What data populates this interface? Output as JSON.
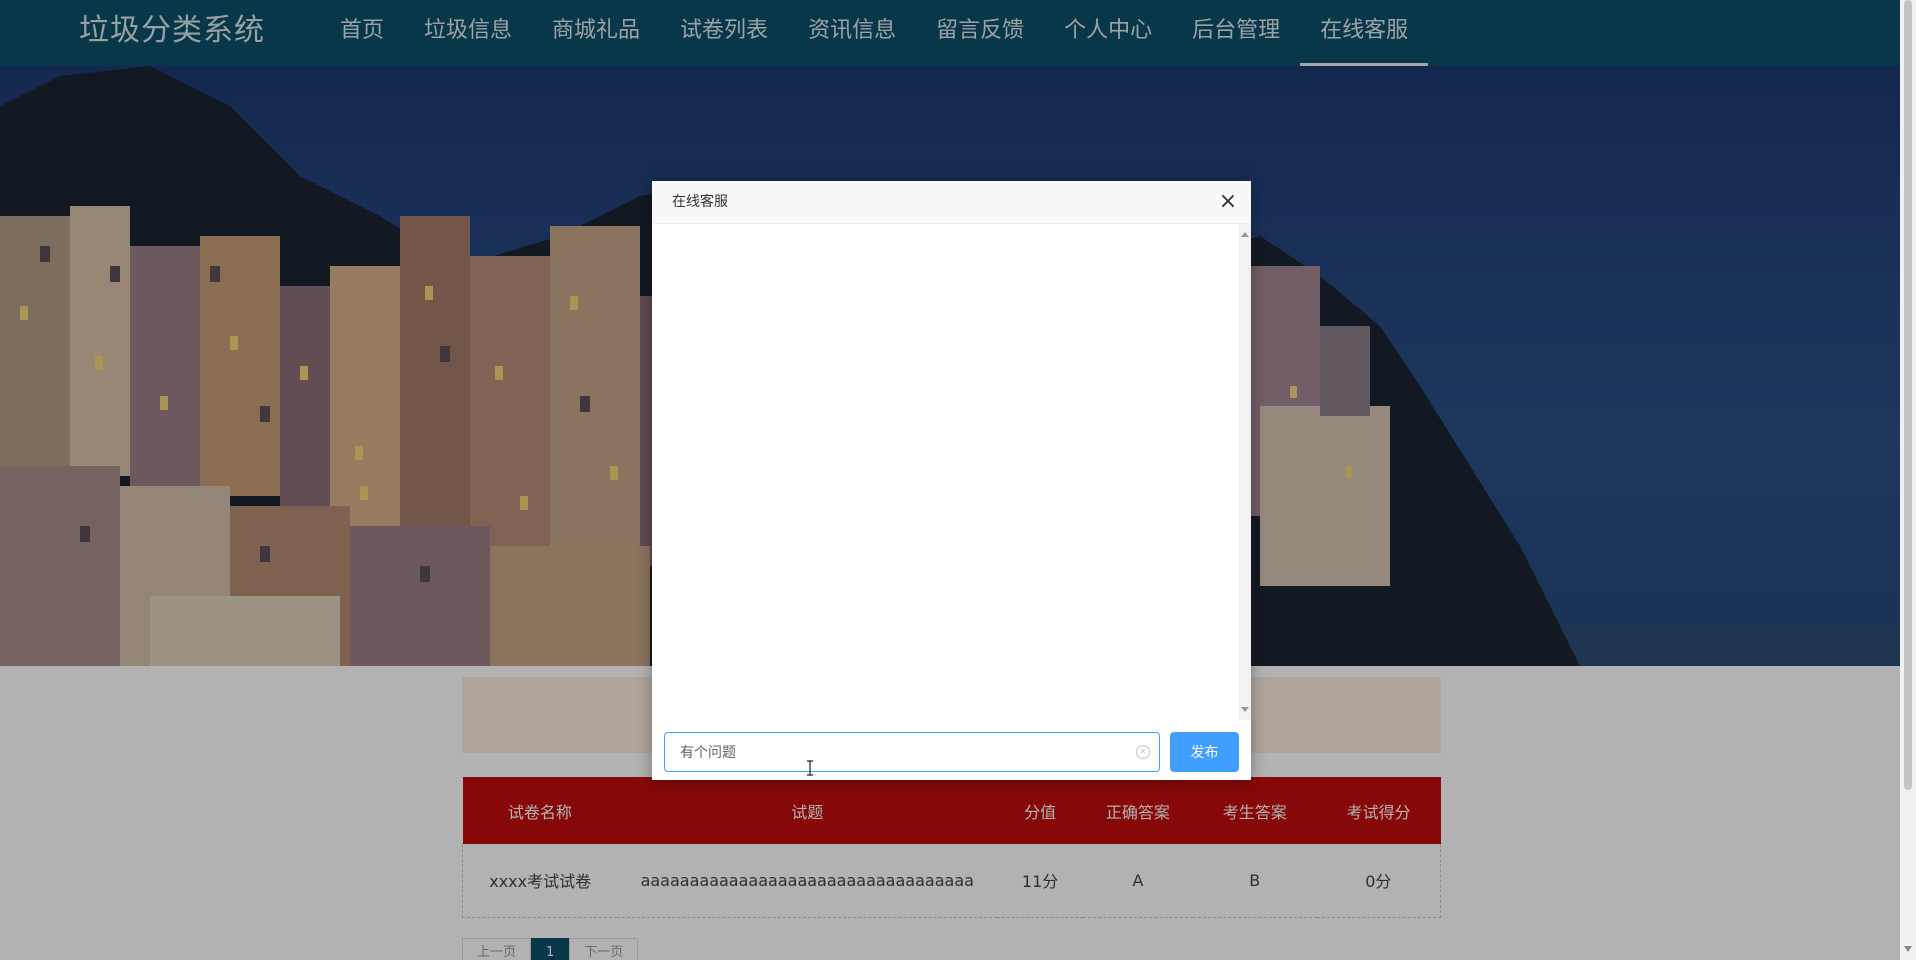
{
  "header": {
    "brand": "垃圾分类系统",
    "nav": [
      {
        "label": "首页"
      },
      {
        "label": "垃圾信息"
      },
      {
        "label": "商城礼品"
      },
      {
        "label": "试卷列表"
      },
      {
        "label": "资讯信息"
      },
      {
        "label": "留言反馈"
      },
      {
        "label": "个人中心"
      },
      {
        "label": "后台管理"
      },
      {
        "label": "在线客服",
        "active": true
      }
    ]
  },
  "exam_table": {
    "headers": [
      "试卷名称",
      "试题",
      "分值",
      "正确答案",
      "考生答案",
      "考试得分"
    ],
    "rows": [
      [
        "xxxx考试试卷",
        "aaaaaaaaaaaaaaaaaaaaaaaaaaaaaaaaaa",
        "11分",
        "A",
        "B",
        "0分"
      ]
    ]
  },
  "pagination": {
    "prev": "上一页",
    "current": "1",
    "next": "下一页"
  },
  "chat_dialog": {
    "title": "在线客服",
    "close_symbol": "×",
    "input_value": "有个问题",
    "send_label": "发布"
  },
  "colors": {
    "nav_bg": "#0b4f67",
    "table_header_bg": "#c20c0c",
    "primary_button": "#409eff",
    "notice_bg": "#fbece0"
  }
}
